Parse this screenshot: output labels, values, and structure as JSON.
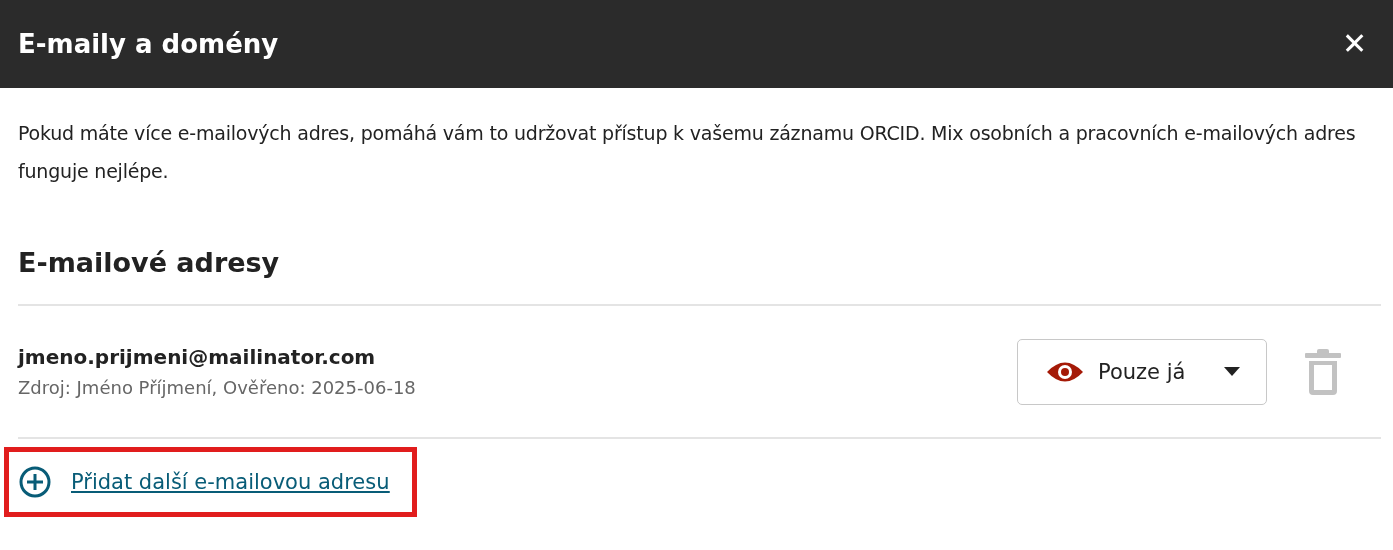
{
  "dialog": {
    "title": "E-maily a domény",
    "close": "✕"
  },
  "intro": "Pokud máte více e-mailových adres, pomáhá vám to udržovat přístup k vašemu záznamu ORCID. Mix osobních a pracovních e-mailových adres funguje nejlépe.",
  "section": {
    "heading": "E-mailové adresy"
  },
  "emails": [
    {
      "address": "jmeno.prijmeni@mailinator.com",
      "meta": "Zdroj: Jméno Příjmení, Ověřeno: 2025-06-18",
      "visibility": "Pouze já",
      "delete_disabled": true
    }
  ],
  "add_link": {
    "label": "Přidat další e-mailovou adresu",
    "highlighted": true
  }
}
